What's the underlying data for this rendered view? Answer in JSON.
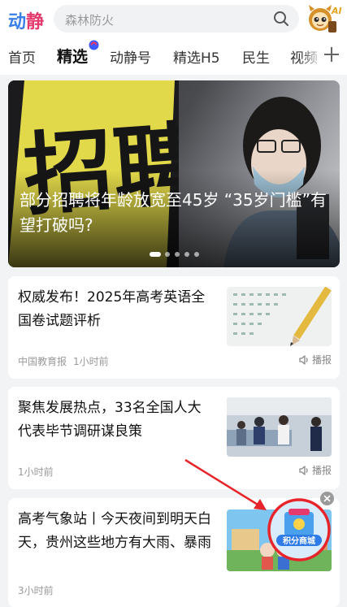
{
  "header": {
    "logo_part1": "动",
    "logo_part2": "静",
    "search_placeholder": "森林防火",
    "ai_badge": "AI"
  },
  "tabs": [
    {
      "label": "首页",
      "active": false
    },
    {
      "label": "精选",
      "active": true
    },
    {
      "label": "动静号",
      "active": false
    },
    {
      "label": "精选H5",
      "active": false
    },
    {
      "label": "民生",
      "active": false
    },
    {
      "label": "视频",
      "active": false
    }
  ],
  "hero": {
    "title": "部分招聘将年龄放宽至45岁 “35岁门槛”有望打破吗?",
    "sign_text": "招聘",
    "carousel_total": 5,
    "carousel_active": 1
  },
  "articles": [
    {
      "title": "权威发布！2025年高考英语全国卷试题评析",
      "source": "中国教育报",
      "time": "1小时前",
      "action": "播报",
      "thumb": "answer-sheet"
    },
    {
      "title": "聚焦发展热点，33名全国人大代表毕节调研谋良策",
      "source": "",
      "time": "1小时前",
      "action": "播报",
      "thumb": "workshop"
    },
    {
      "title": "高考气象站丨今天夜间到明天白天，贵州这些地方有大雨、暴雨",
      "source": "",
      "time": "3小时前",
      "action": "",
      "thumb": "cartoon"
    }
  ],
  "floating_badge": {
    "label": "积分商城"
  },
  "colors": {
    "accent_blue": "#3a7ee8",
    "accent_pink": "#e5396e",
    "highlight_red": "#e8242b"
  }
}
